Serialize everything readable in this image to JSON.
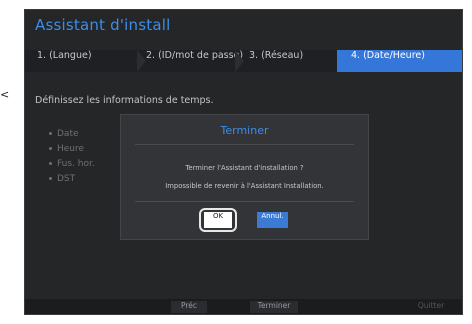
{
  "left_marker": "<",
  "window": {
    "title": "Assistant d'install"
  },
  "steps": [
    {
      "label": "1.  (Langue)",
      "active": false
    },
    {
      "label": "2.  (ID/mot de passe)",
      "active": false
    },
    {
      "label": "3.  (Réseau)",
      "active": false
    },
    {
      "label": "4.  (Date/Heure)",
      "active": true
    }
  ],
  "main": {
    "instruction": "Définissez les informations de temps.",
    "fields": [
      "Date",
      "Heure",
      "Fus. hor.",
      "DST"
    ]
  },
  "dialog": {
    "title": "Terminer",
    "line1": "Terminer l'Assistant d'installation ?",
    "line2": "Impossible de revenir à l'Assistant Installation.",
    "ok_label": "OK",
    "cancel_label": "Annul."
  },
  "footer": {
    "prev_label": "Préc",
    "finish_label": "Terminer",
    "quit_label": "Quitter"
  },
  "colors": {
    "accent": "#3c8ee8",
    "active_step": "#3577d9",
    "background": "#252628"
  }
}
